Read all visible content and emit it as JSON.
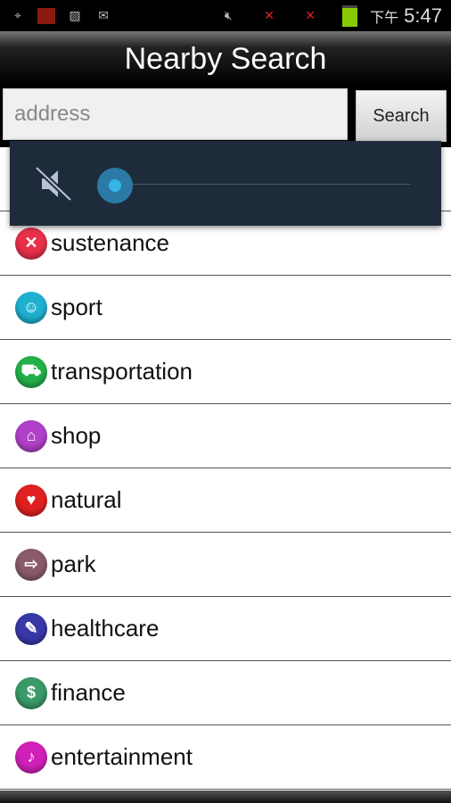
{
  "status_bar": {
    "am_pm": "下午",
    "time": "5:47",
    "icons": [
      "gps-icon",
      "flag-icon",
      "image-icon",
      "gmail-icon",
      "mute-icon",
      "no-signal-icon",
      "no-signal-icon",
      "battery-icon"
    ]
  },
  "header": {
    "title": "Nearby Search"
  },
  "search": {
    "placeholder": "address",
    "button_label": "Search"
  },
  "categories": [
    {
      "label": "sustenance",
      "color": "#e8304a",
      "glyph": "✕"
    },
    {
      "label": "sport",
      "color": "#1fb0d0",
      "glyph": "☺"
    },
    {
      "label": "transportation",
      "color": "#22b04a",
      "glyph": "⛟"
    },
    {
      "label": "shop",
      "color": "#b040c8",
      "glyph": "⌂"
    },
    {
      "label": "natural",
      "color": "#e02020",
      "glyph": "♥"
    },
    {
      "label": "park",
      "color": "#8a5a68",
      "glyph": "⇨"
    },
    {
      "label": "healthcare",
      "color": "#3838a8",
      "glyph": "✎"
    },
    {
      "label": "finance",
      "color": "#3a9a6a",
      "glyph": "$"
    },
    {
      "label": "entertainment",
      "color": "#d020b8",
      "glyph": "♪"
    }
  ],
  "volume_popup": {
    "muted": true,
    "level": 0,
    "accent": "#33b5e5"
  }
}
